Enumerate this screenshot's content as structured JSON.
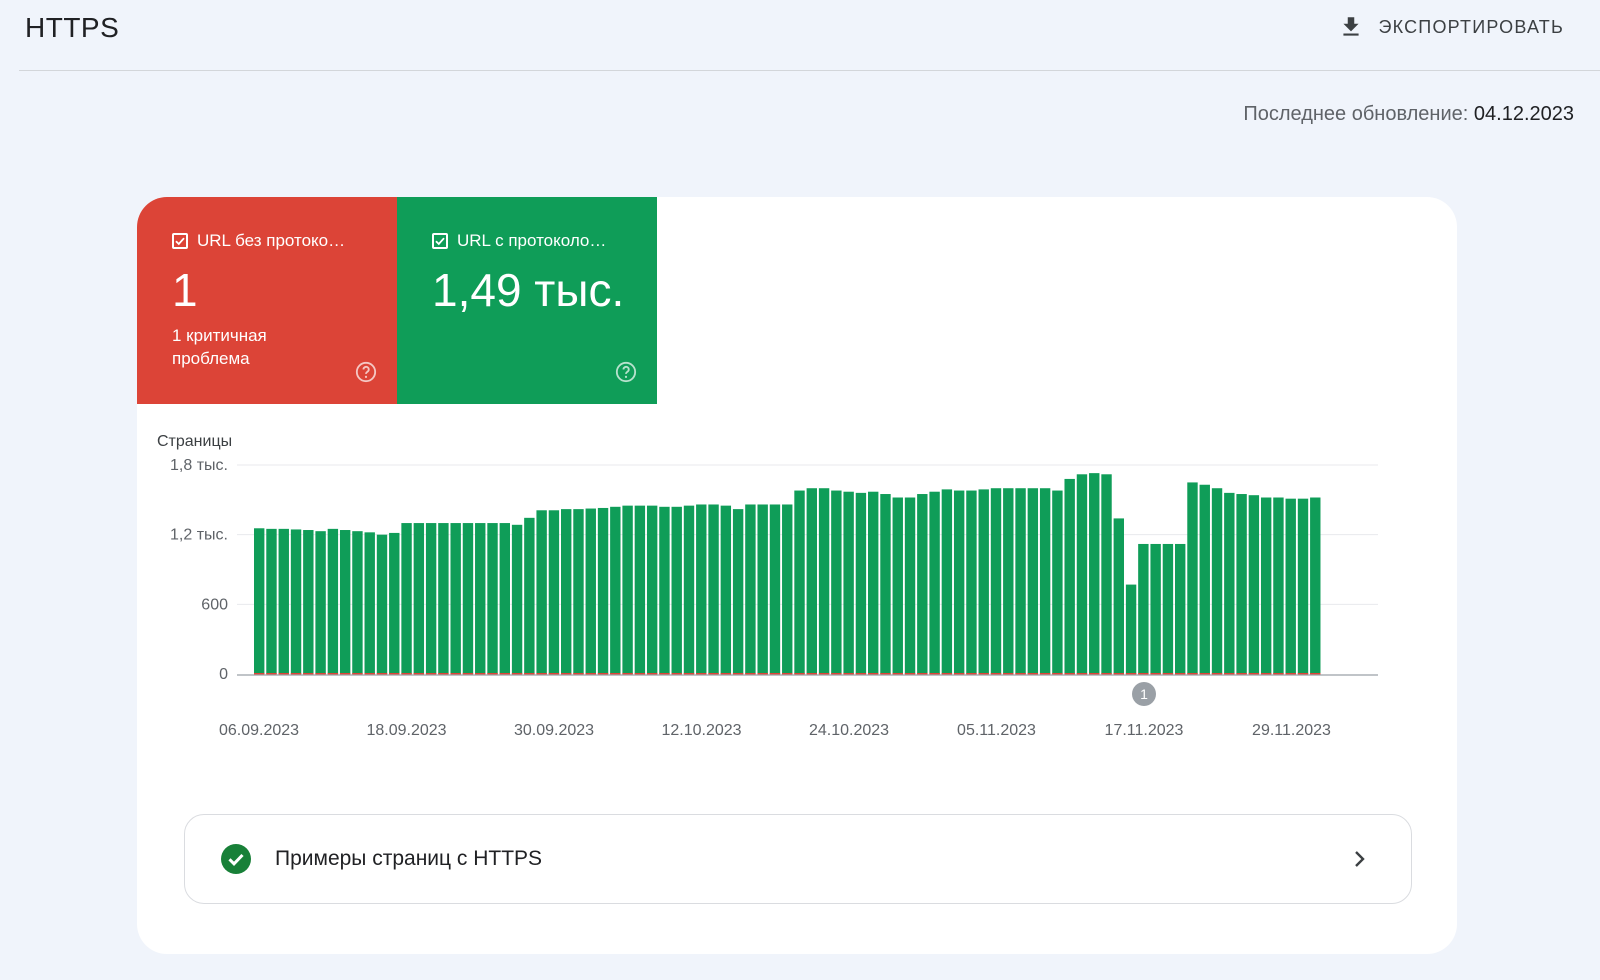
{
  "header": {
    "title": "HTTPS",
    "export_label": "ЭКСПОРТИРОВАТЬ"
  },
  "last_update": {
    "label": "Последнее обновление:",
    "date": "04.12.2023"
  },
  "tiles": [
    {
      "label": "URL без протоко…",
      "value": "1",
      "note": "1 критичная проблема",
      "color": "#dc4437",
      "checked": true
    },
    {
      "label": "URL с протоколо…",
      "value": "1,49 тыс.",
      "note": "",
      "color": "#0f9d58",
      "checked": true
    }
  ],
  "chart_data": {
    "type": "bar",
    "ylabel": "Страницы",
    "yticks": [
      "0",
      "600",
      "1,2 тыс.",
      "1,8 тыс."
    ],
    "ylim": [
      0,
      1800
    ],
    "xticks": [
      "06.09.2023",
      "18.09.2023",
      "30.09.2023",
      "12.10.2023",
      "24.10.2023",
      "05.11.2023",
      "17.11.2023",
      "29.11.2023"
    ],
    "grid": true,
    "annotation": {
      "text": "1",
      "date": "17.11.2023"
    },
    "series": [
      {
        "name": "URL с протоколо…",
        "color": "#0f9d58",
        "values": [
          1255,
          1250,
          1250,
          1245,
          1240,
          1230,
          1250,
          1240,
          1230,
          1220,
          1200,
          1215,
          1300,
          1300,
          1300,
          1300,
          1300,
          1300,
          1300,
          1300,
          1300,
          1285,
          1345,
          1410,
          1410,
          1420,
          1420,
          1425,
          1430,
          1440,
          1450,
          1450,
          1450,
          1440,
          1440,
          1450,
          1460,
          1460,
          1450,
          1420,
          1460,
          1460,
          1460,
          1460,
          1580,
          1600,
          1600,
          1580,
          1570,
          1560,
          1570,
          1550,
          1520,
          1520,
          1550,
          1570,
          1590,
          1580,
          1580,
          1590,
          1600,
          1600,
          1600,
          1600,
          1600,
          1580,
          1680,
          1720,
          1730,
          1720,
          1340,
          770,
          1120,
          1120,
          1120,
          1120,
          1650,
          1630,
          1600,
          1560,
          1550,
          1540,
          1520,
          1520,
          1510,
          1510,
          1520
        ]
      },
      {
        "name": "URL без протоко…",
        "color": "#dc4437",
        "values": [
          1,
          1,
          1,
          1,
          1,
          1,
          1,
          1,
          1,
          1,
          1,
          1,
          1,
          1,
          1,
          1,
          1,
          1,
          1,
          1,
          1,
          1,
          1,
          1,
          1,
          1,
          1,
          1,
          1,
          1,
          1,
          1,
          1,
          1,
          1,
          1,
          1,
          1,
          1,
          1,
          1,
          1,
          1,
          1,
          1,
          1,
          1,
          1,
          1,
          1,
          1,
          1,
          1,
          1,
          1,
          1,
          1,
          1,
          1,
          1,
          1,
          1,
          1,
          1,
          1,
          1,
          1,
          1,
          1,
          1,
          1,
          1,
          1,
          1,
          1,
          1,
          1,
          1,
          1,
          1,
          1,
          1,
          1,
          1,
          1,
          1,
          1
        ]
      }
    ]
  },
  "examples": {
    "label": "Примеры страниц с HTTPS"
  }
}
